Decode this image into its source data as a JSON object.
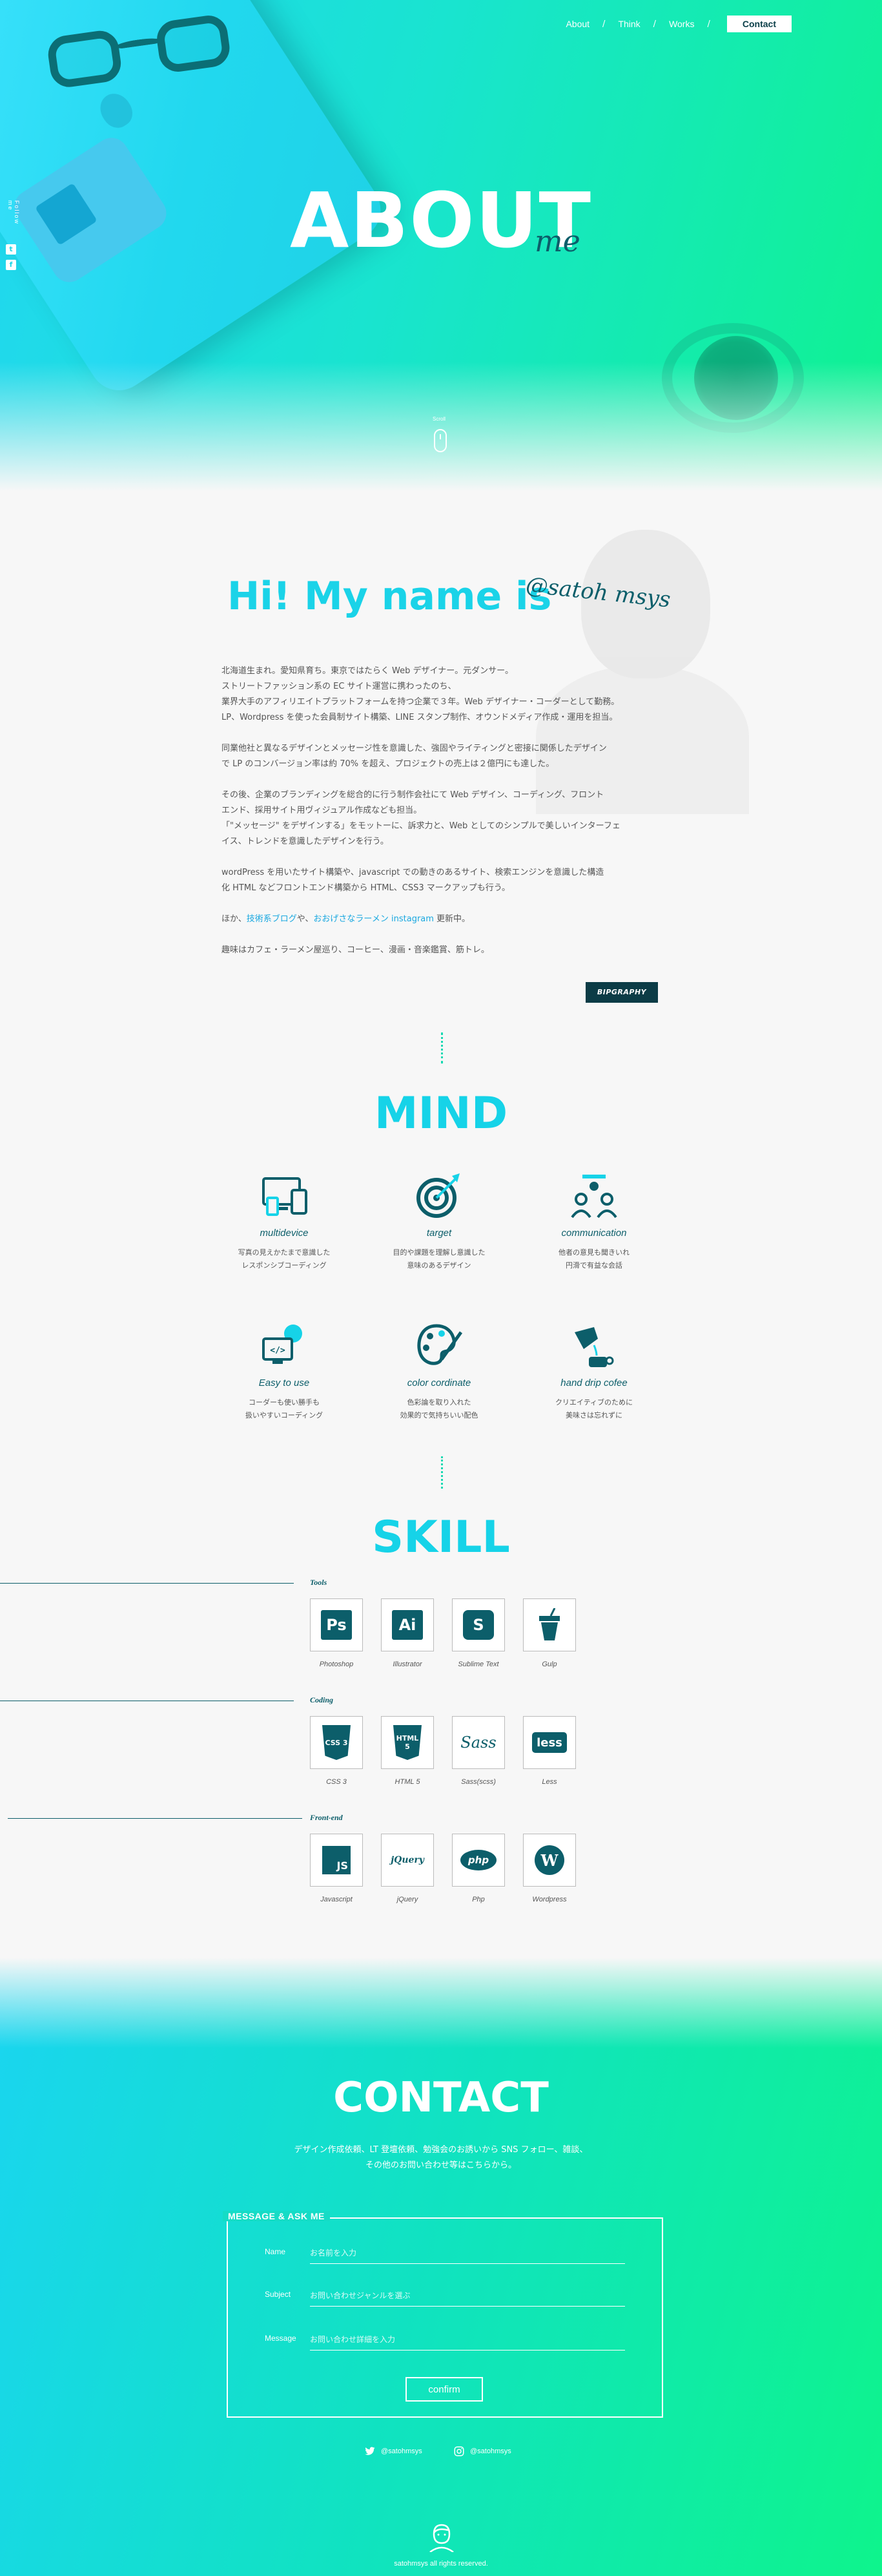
{
  "nav": {
    "items": [
      "About",
      "Think",
      "Works"
    ],
    "separator": "/",
    "contact": "Contact"
  },
  "side": {
    "text": "Follow me",
    "twitter_glyph": "t",
    "facebook_glyph": "f"
  },
  "hero": {
    "title": "ABOUT",
    "subtitle": "me",
    "scroll_label": "Scroll"
  },
  "about": {
    "greeting": "Hi! My name is",
    "handle": "@satoh msys",
    "paragraphs": [
      [
        "北海道生まれ。愛知県育ち。東京ではたらく Web デザイナー。元ダンサー。",
        "ストリートファッション系の EC サイト運営に携わったのち、",
        "業界大手のアフィリエイトプラットフォームを持つ企業で３年。Web デザイナー・コーダーとして勤務。",
        "LP、Wordpress を使った会員制サイト構築、LINE スタンプ制作、オウンドメディア作成・運用を担当。"
      ],
      [
        "同業他社と異なるデザインとメッセージ性を意識した、強固やライティングと密接に関係したデザイン",
        "で LP のコンバージョン率は約 70% を超え、プロジェクトの売上は２億円にも達した。"
      ],
      [
        "その後、企業のブランディングを総合的に行う制作会社にて Web デザイン、コーディング、フロント",
        "エンド、採用サイト用ヴィジュアル作成なども担当。",
        "「\"メッセージ\" をデザインする」をモットーに、訴求力と、Web としてのシンプルで美しいインターフェ",
        "イス、トレンドを意識したデザインを行う。"
      ],
      [
        "wordPress を用いたサイト構築や、javascript での動きのあるサイト、検索エンジンを意識した構造",
        "化 HTML などフロントエンド構築から HTML、CSS3 マークアップも行う。"
      ]
    ],
    "links_prefix": "ほか、",
    "link1": "技術系ブログ",
    "links_mid": "や、",
    "link2": "おおげさなラーメン instagram",
    "links_suffix": " 更新中。",
    "hobby": "趣味はカフェ・ラーメン屋巡り、コーヒー、漫画・音楽鑑賞、筋トレ。",
    "biography_button": "BIPGRAPHY"
  },
  "mind": {
    "title": "MIND",
    "items": [
      {
        "icon": "multidevice-icon",
        "label": "multidevice",
        "desc1": "写真の見えかたまで意識した",
        "desc2": "レスポンシブコーディング"
      },
      {
        "icon": "target-icon",
        "label": "target",
        "desc1": "目的や課題を理解し意識した",
        "desc2": "意味のあるデザイン"
      },
      {
        "icon": "communication-icon",
        "label": "communication",
        "desc1": "他者の意見も聞きいれ",
        "desc2": "円滑で有益な会話"
      },
      {
        "icon": "easy-to-use-icon",
        "label": "Easy to use",
        "desc1": "コーダーも使い勝手も",
        "desc2": "扱いやすいコーディング"
      },
      {
        "icon": "color-palette-icon",
        "label": "color cordinate",
        "desc1": "色彩論を取り入れた",
        "desc2": "効果的で気持ちいい配色"
      },
      {
        "icon": "coffee-drip-icon",
        "label": "hand drip cofee",
        "desc1": "クリエイティブのために",
        "desc2": "美味さは忘れずに"
      }
    ]
  },
  "skill": {
    "title": "SKILL",
    "categories": [
      {
        "name": "Tools",
        "items": [
          {
            "badge": "Ps",
            "name": "Photoshop"
          },
          {
            "badge": "Ai",
            "name": "Illustrator"
          },
          {
            "badge": "S",
            "name": "Sublime Text"
          },
          {
            "badge": "",
            "name": "Gulp"
          }
        ]
      },
      {
        "name": "Coding",
        "items": [
          {
            "badge": "CSS 3",
            "name": "CSS 3"
          },
          {
            "badge": "HTML 5",
            "name": "HTML 5"
          },
          {
            "badge": "Sass",
            "name": "Sass(scss)"
          },
          {
            "badge": "less",
            "name": "Less"
          }
        ]
      },
      {
        "name": "Front-end",
        "items": [
          {
            "badge": "JS",
            "name": "Javascript"
          },
          {
            "badge": "jQuery",
            "name": "jQuery"
          },
          {
            "badge": "php",
            "name": "Php"
          },
          {
            "badge": "W",
            "name": "Wordpress"
          }
        ]
      }
    ]
  },
  "contact": {
    "title": "CONTACT",
    "intro1": "デザイン作成依頼、LT 登壇依頼、勉強会のお誘いから SNS フォロー、雑談、",
    "intro2": "その他のお問い合わせ等はこちらから。",
    "legend": "MESSAGE & ASK ME",
    "fields": [
      {
        "label": "Name",
        "placeholder": "お名前を入力"
      },
      {
        "label": "Subject",
        "placeholder": "お問い合わせジャンルを選ぶ"
      },
      {
        "label": "Message",
        "placeholder": "お問い合わせ詳細を入力"
      }
    ],
    "confirm": "confirm",
    "twitter": "@satohmsys",
    "instagram": "@satohmsys",
    "copyright": "satohmsys all rights reserved."
  },
  "colors": {
    "accent": "#1ad3e8",
    "dark": "#0c5e6a",
    "green": "#0ef48c"
  }
}
